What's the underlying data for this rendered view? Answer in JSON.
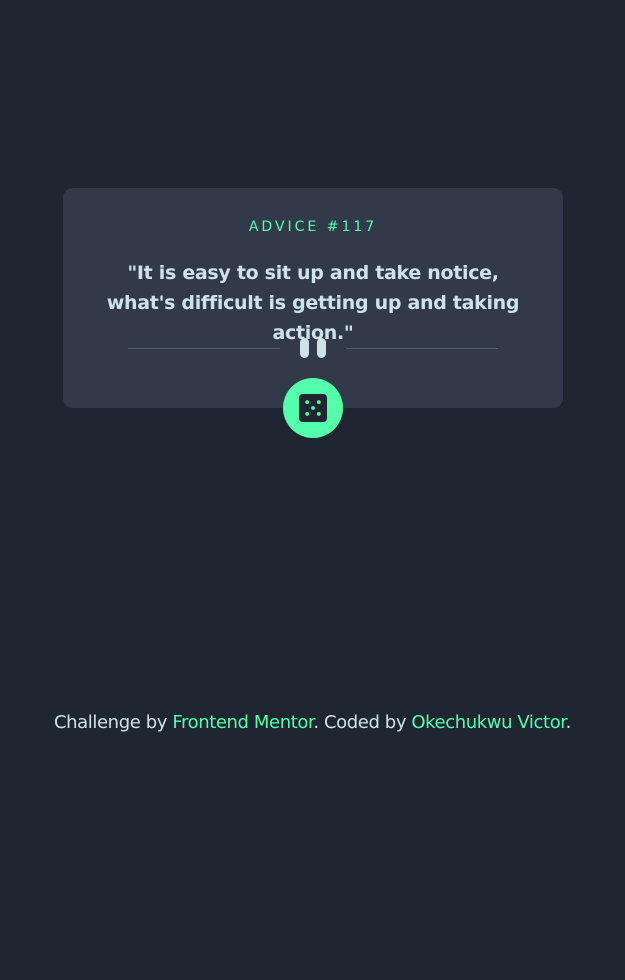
{
  "advice": {
    "label": "ADVICE #117",
    "text": "\"It is easy to sit up and take notice, what's difficult is getting up and taking action.\""
  },
  "icons": {
    "divider": "pause-divider-icon",
    "button": "dice-icon"
  },
  "attribution": {
    "prefix": "Challenge by ",
    "link1": "Frontend Mentor",
    "middle": ". Coded by ",
    "link2": "Okechukwu Victor",
    "suffix": "."
  },
  "colors": {
    "background": "#1f2632",
    "card": "#323a49",
    "accent": "#53ffaa",
    "text": "#cee3e9",
    "divider": "#4f5d74"
  }
}
